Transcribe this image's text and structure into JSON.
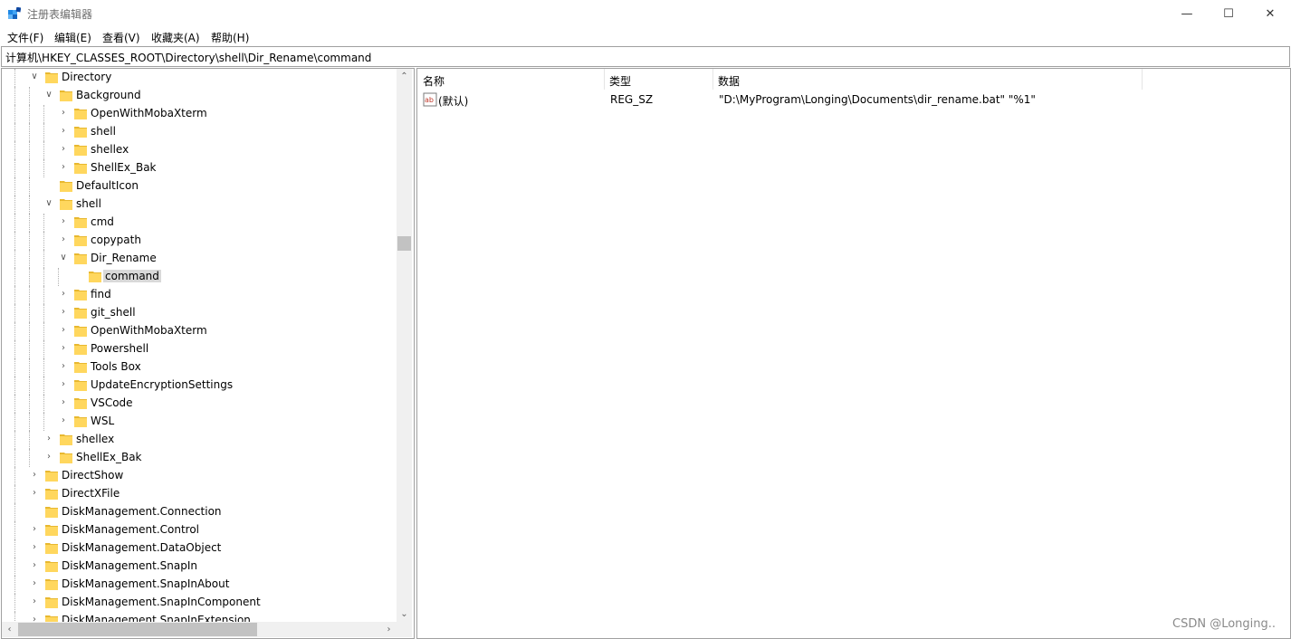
{
  "window": {
    "title": "注册表编辑器",
    "controls": {
      "minimize": "—",
      "maximize": "☐",
      "close": "✕"
    }
  },
  "menu": [
    "文件(F)",
    "编辑(E)",
    "查看(V)",
    "收藏夹(A)",
    "帮助(H)"
  ],
  "address_path": "计算机\\HKEY_CLASSES_ROOT\\Directory\\shell\\Dir_Rename\\command",
  "tree": [
    {
      "label": "Directory",
      "depth": 0,
      "state": "expanded"
    },
    {
      "label": "Background",
      "depth": 1,
      "state": "expanded"
    },
    {
      "label": "OpenWithMobaXterm",
      "depth": 2,
      "state": "collapsed"
    },
    {
      "label": "shell",
      "depth": 2,
      "state": "collapsed"
    },
    {
      "label": "shellex",
      "depth": 2,
      "state": "collapsed"
    },
    {
      "label": "ShellEx_Bak",
      "depth": 2,
      "state": "collapsed"
    },
    {
      "label": "DefaultIcon",
      "depth": 1,
      "state": "leaf"
    },
    {
      "label": "shell",
      "depth": 1,
      "state": "expanded"
    },
    {
      "label": "cmd",
      "depth": 2,
      "state": "collapsed"
    },
    {
      "label": "copypath",
      "depth": 2,
      "state": "collapsed"
    },
    {
      "label": "Dir_Rename",
      "depth": 2,
      "state": "expanded"
    },
    {
      "label": "command",
      "depth": 3,
      "state": "leaf",
      "selected": true
    },
    {
      "label": "find",
      "depth": 2,
      "state": "collapsed"
    },
    {
      "label": "git_shell",
      "depth": 2,
      "state": "collapsed"
    },
    {
      "label": "OpenWithMobaXterm",
      "depth": 2,
      "state": "collapsed"
    },
    {
      "label": "Powershell",
      "depth": 2,
      "state": "collapsed"
    },
    {
      "label": "Tools Box",
      "depth": 2,
      "state": "collapsed"
    },
    {
      "label": "UpdateEncryptionSettings",
      "depth": 2,
      "state": "collapsed"
    },
    {
      "label": "VSCode",
      "depth": 2,
      "state": "collapsed"
    },
    {
      "label": "WSL",
      "depth": 2,
      "state": "collapsed"
    },
    {
      "label": "shellex",
      "depth": 1,
      "state": "collapsed"
    },
    {
      "label": "ShellEx_Bak",
      "depth": 1,
      "state": "collapsed"
    },
    {
      "label": "DirectShow",
      "depth": 0,
      "state": "collapsed"
    },
    {
      "label": "DirectXFile",
      "depth": 0,
      "state": "collapsed"
    },
    {
      "label": "DiskManagement.Connection",
      "depth": 0,
      "state": "leaf"
    },
    {
      "label": "DiskManagement.Control",
      "depth": 0,
      "state": "collapsed"
    },
    {
      "label": "DiskManagement.DataObject",
      "depth": 0,
      "state": "collapsed"
    },
    {
      "label": "DiskManagement.SnapIn",
      "depth": 0,
      "state": "collapsed"
    },
    {
      "label": "DiskManagement.SnapInAbout",
      "depth": 0,
      "state": "collapsed"
    },
    {
      "label": "DiskManagement.SnapInComponent",
      "depth": 0,
      "state": "collapsed"
    },
    {
      "label": "DiskManagement.SnapInExtension",
      "depth": 0,
      "state": "collapsed"
    }
  ],
  "list": {
    "columns": [
      "名称",
      "类型",
      "数据"
    ],
    "rows": [
      {
        "name": "(默认)",
        "type": "REG_SZ",
        "data": "\"D:\\MyProgram\\Longing\\Documents\\dir_rename.bat\" \"%1\""
      }
    ]
  },
  "watermark": "CSDN @Longing..",
  "colors": {
    "folder": "#ffd75e",
    "folder_dark": "#e8b830",
    "selection": "#d9d9d9",
    "border": "#a0a0a0"
  }
}
